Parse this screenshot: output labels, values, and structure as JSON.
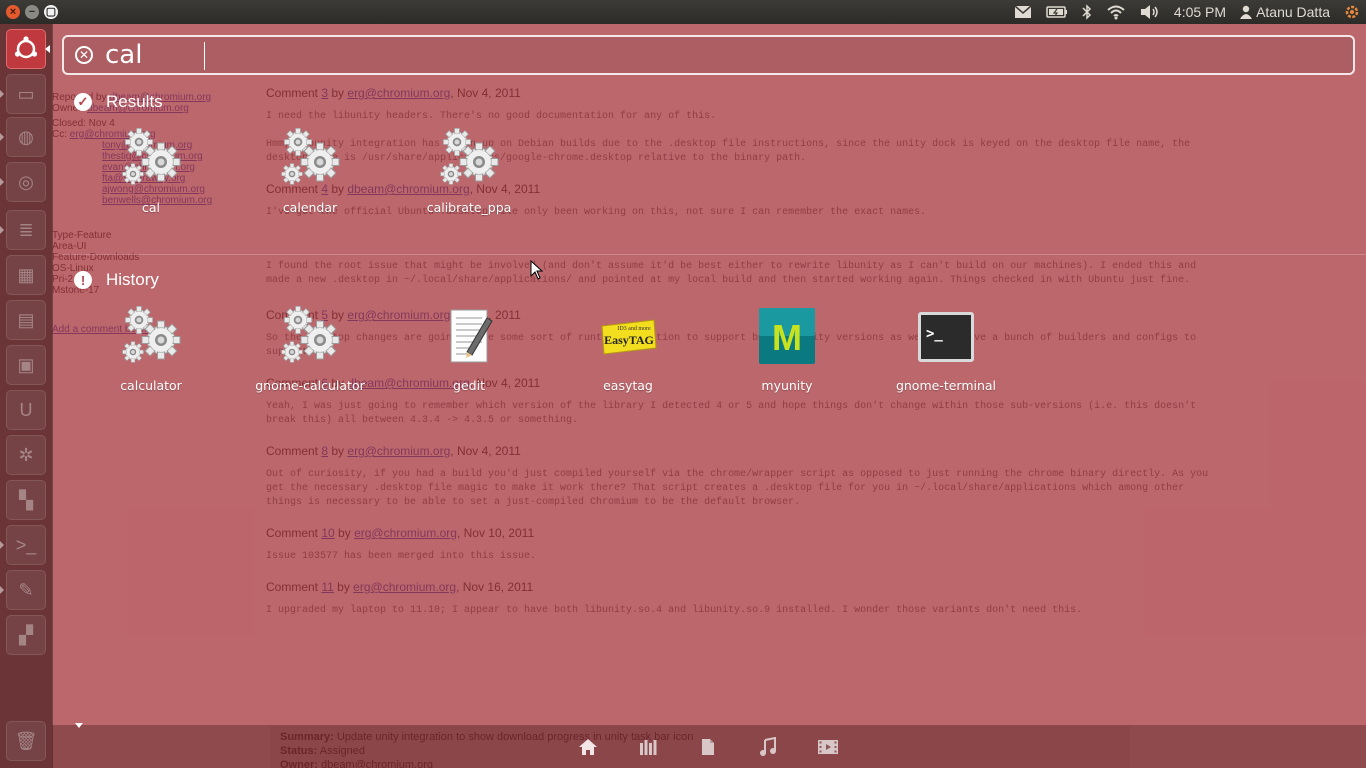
{
  "top_panel": {
    "clock": "4:05 PM",
    "user": "Atanu Datta",
    "indicators": [
      "mail-icon",
      "battery-icon",
      "bluetooth-icon",
      "wifi-icon",
      "volume-icon",
      "power-gear-icon"
    ]
  },
  "search": {
    "query": "cal"
  },
  "categories": {
    "results": {
      "title": "Results",
      "items": [
        {
          "label": "cal",
          "icon": "gears-icon"
        },
        {
          "label": "calendar",
          "icon": "gears-icon"
        },
        {
          "label": "calibrate_ppa",
          "icon": "gears-icon"
        }
      ]
    },
    "history": {
      "title": "History",
      "items": [
        {
          "label": "calculator",
          "icon": "gears-icon"
        },
        {
          "label": "gnome-calculator",
          "icon": "gears-icon"
        },
        {
          "label": "gedit",
          "icon": "text-editor-icon"
        },
        {
          "label": "easytag",
          "icon": "easytag-icon",
          "icon_text": "EasyTAG",
          "icon_subtext": "ID3 and more"
        },
        {
          "label": "myunity",
          "icon": "myunity-icon",
          "icon_text": "M"
        },
        {
          "label": "gnome-terminal",
          "icon": "terminal-icon",
          "icon_text": ">_"
        }
      ]
    }
  },
  "lens_bar": [
    "home-lens-icon",
    "applications-lens-icon",
    "files-lens-icon",
    "music-lens-icon",
    "video-lens-icon"
  ],
  "launcher": [
    "dash-home-icon",
    "files-icon",
    "firefox-icon",
    "chromium-icon",
    "document-icon",
    "spreadsheet-icon",
    "presentation-icon",
    "software-center-icon",
    "ubuntu-one-icon",
    "settings-icon",
    "workspace-icon",
    "terminal-icon",
    "text-editor-icon",
    "system-monitor-icon",
    "trash-icon"
  ],
  "colors": {
    "dash_tint": "#a8343c",
    "bfb": "#c0393f",
    "panel": "#3c3b37"
  }
}
